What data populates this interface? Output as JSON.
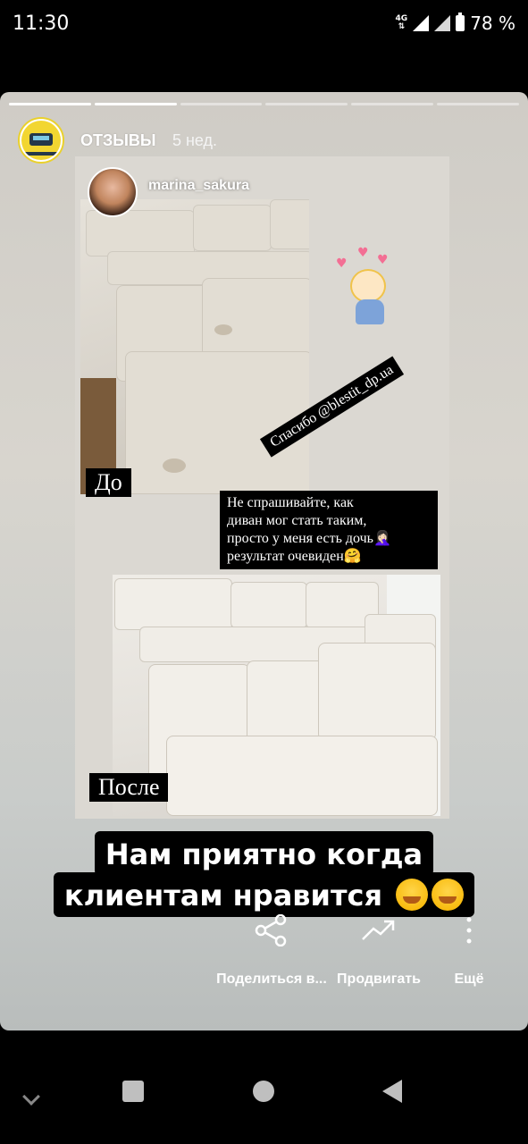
{
  "status": {
    "time": "11:30",
    "network": "4G",
    "battery": "78 %"
  },
  "story": {
    "title": "ОТЗЫВЫ",
    "age": "5 нед.",
    "progress_segments": 6,
    "progress_done": 2
  },
  "collage": {
    "ig_username": "marina_sakura",
    "label_before": "До",
    "label_after": "После",
    "thanks_text": "Спасибо @blestit_dp.ua",
    "quote_lines": [
      "Не спрашивайте, как",
      "диван мог стать таким,",
      "просто у меня есть дочь🤦🏻‍♀️",
      "результат очевиден🤗"
    ]
  },
  "caption": {
    "line1": "Нам приятно когда",
    "line2": "клиентам нравится"
  },
  "actions": {
    "share_label": "Поделиться в...",
    "promote_label": "Продвигать",
    "more_label": "Ещё"
  },
  "icons": {
    "share": "share-icon",
    "promote": "trending-up-icon",
    "more": "more-vertical-icon"
  }
}
